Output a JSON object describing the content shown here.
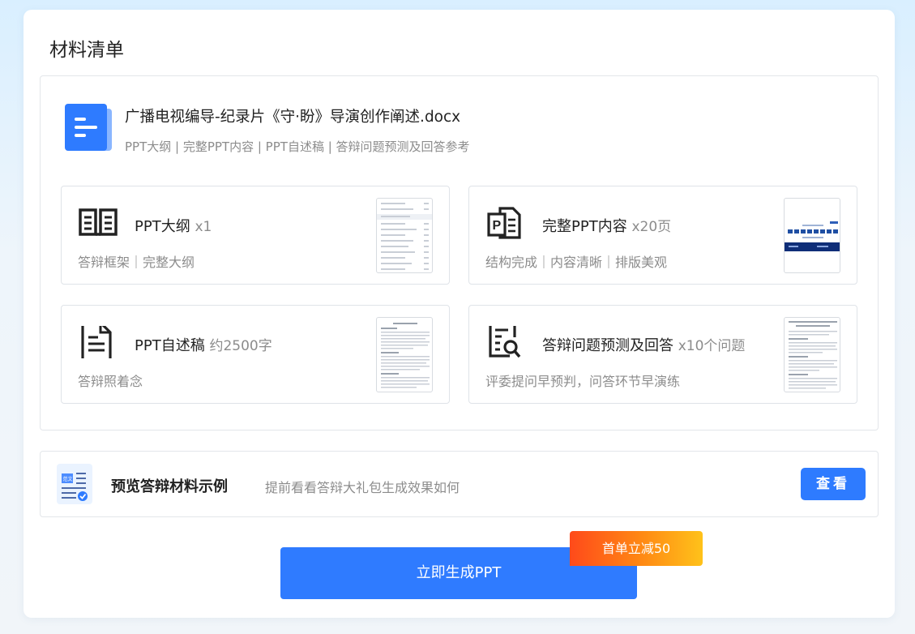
{
  "section_title": "材料清单",
  "document": {
    "name": "广播电视编导-纪录片《守·盼》导演创作阐述.docx",
    "tags": "PPT大纲 | 完整PPT内容 | PPT自述稿 | 答辩问题预测及回答参考"
  },
  "items": [
    {
      "name": "PPT大纲",
      "qty": "x1",
      "desc": "答辩框架｜完整大纲",
      "icon": "book-open-icon"
    },
    {
      "name": "完整PPT内容",
      "qty": "x20页",
      "desc": "结构完成｜内容清晰｜排版美观",
      "icon": "ppt-file-icon"
    },
    {
      "name": "PPT自述稿",
      "qty": "约2500字",
      "desc": "答辩照着念",
      "icon": "text-document-icon"
    },
    {
      "name": "答辩问题预测及回答",
      "qty": "x10个问题",
      "desc": "评委提问早预判，问答环节早演练",
      "icon": "search-document-icon"
    }
  ],
  "preview": {
    "title": "预览答辩材料示例",
    "desc": "提前看看答辩大礼包生成效果如何",
    "button": "查看"
  },
  "generate_button": "立即生成PPT",
  "promo_badge": "首单立减50",
  "colors": {
    "primary": "#2e7bff",
    "promo_start": "#ff4a1a",
    "promo_end": "#ffc21a"
  }
}
